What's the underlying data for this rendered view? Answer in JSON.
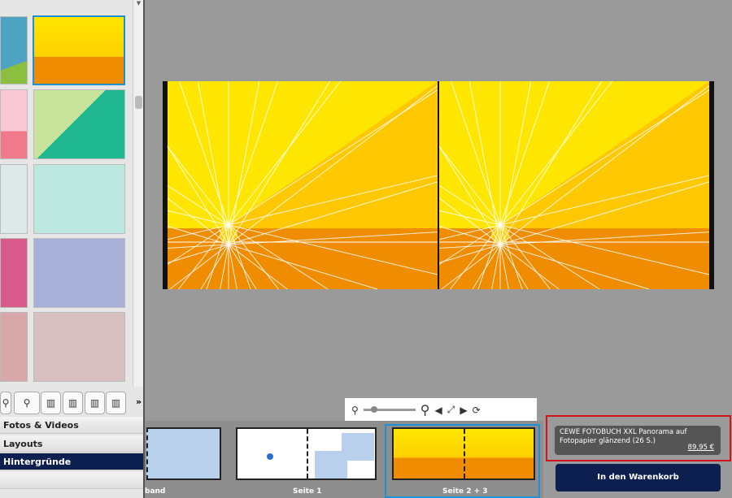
{
  "sidebar": {
    "menu": [
      {
        "label": "Fotos & Videos",
        "shown": "Videos"
      },
      {
        "label": "Layouts",
        "shown": "outs"
      },
      {
        "label": "Hintergründe",
        "shown": "nde",
        "selected": true
      },
      {
        "label": "",
        "shown": ""
      }
    ],
    "more_label": "»"
  },
  "toolbar": {
    "zoom_level": 0.15
  },
  "filmstrip": {
    "pages": [
      {
        "label": "band"
      },
      {
        "label": "Seite 1"
      },
      {
        "label": "Seite 2 + 3",
        "selected": true
      }
    ]
  },
  "product": {
    "name": "CEWE FOTOBUCH XXL Panorama auf Fotopapier glänzend (26 S.)",
    "price": "89,95 €"
  },
  "cart_button": "In den Warenkorb",
  "colors": {
    "accent": "#0d1f4f",
    "highlight": "#d0141c",
    "selection": "#1e90d6",
    "yellow": "#ffe600",
    "orange": "#f08c00"
  }
}
